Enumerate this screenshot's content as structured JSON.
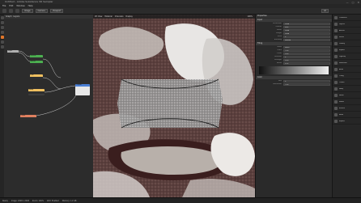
{
  "window": {
    "title": "Untitled - Adobe Substance 3D Sampler",
    "controls": [
      "—",
      "□",
      "✕"
    ]
  },
  "menu": [
    "File",
    "Edit",
    "Window",
    "Help"
  ],
  "toolbar": {
    "dropdowns": [
      "Image",
      "Camera",
      "Viewport"
    ],
    "right_status": "Lit"
  },
  "node_editor": {
    "tabs": [
      "Graph",
      "Layers"
    ],
    "nodes": [
      {
        "label": "Input",
        "color": "#b0b0b0"
      },
      {
        "label": "Levels",
        "color": "#4caf50"
      },
      {
        "label": "Blend",
        "color": "#4caf50"
      },
      {
        "label": "Tile",
        "color": "#f0c060"
      },
      {
        "label": "Warp",
        "color": "#f0c060"
      },
      {
        "label": "Output",
        "color": "#4a7fd4"
      },
      {
        "label": "Color",
        "color": "#e08060"
      }
    ]
  },
  "viewport": {
    "header": [
      "2D View",
      "Material",
      "Channels",
      "Display"
    ],
    "zoom": "100%"
  },
  "properties": {
    "tab": "Properties",
    "sections": [
      {
        "title": "Input",
        "rows": [
          {
            "label": "Resolution",
            "value": "2048"
          },
          {
            "label": "Format",
            "value": "PNG"
          },
          {
            "label": "Width",
            "value": "2048"
          },
          {
            "label": "Height",
            "value": "2048"
          },
          {
            "label": "Seed",
            "value": "0"
          },
          {
            "label": "Blending",
            "value": "Normal"
          }
        ]
      },
      {
        "title": "Tiling",
        "rows": [
          {
            "label": "Mode",
            "value": "Patch"
          },
          {
            "label": "Scale",
            "value": "1.00"
          },
          {
            "label": "Offset",
            "value": "0.00"
          },
          {
            "label": "Rotation",
            "value": "0"
          },
          {
            "label": "Strength",
            "value": "0.50"
          },
          {
            "label": "Falloff",
            "value": "0.25"
          }
        ]
      },
      {
        "title": "Color",
        "rows": [
          {
            "label": "Hue",
            "value": "0"
          },
          {
            "label": "Saturation",
            "value": "1.00"
          }
        ]
      }
    ]
  },
  "right_panel": {
    "items": [
      "Channels",
      "Layers",
      "Assets",
      "Filters",
      "Library",
      "Export",
      "Lighting",
      "Materials",
      "Atlas",
      "Tiling",
      "Colors",
      "Warp",
      "Noise",
      "Masks",
      "Effects",
      "Bake",
      "Export"
    ]
  },
  "status_bar": [
    "Ready",
    "Image: 2048 x 2048",
    "Zoom: 100%",
    "GPU: Enabled",
    "Memory: 1.2 GB"
  ]
}
